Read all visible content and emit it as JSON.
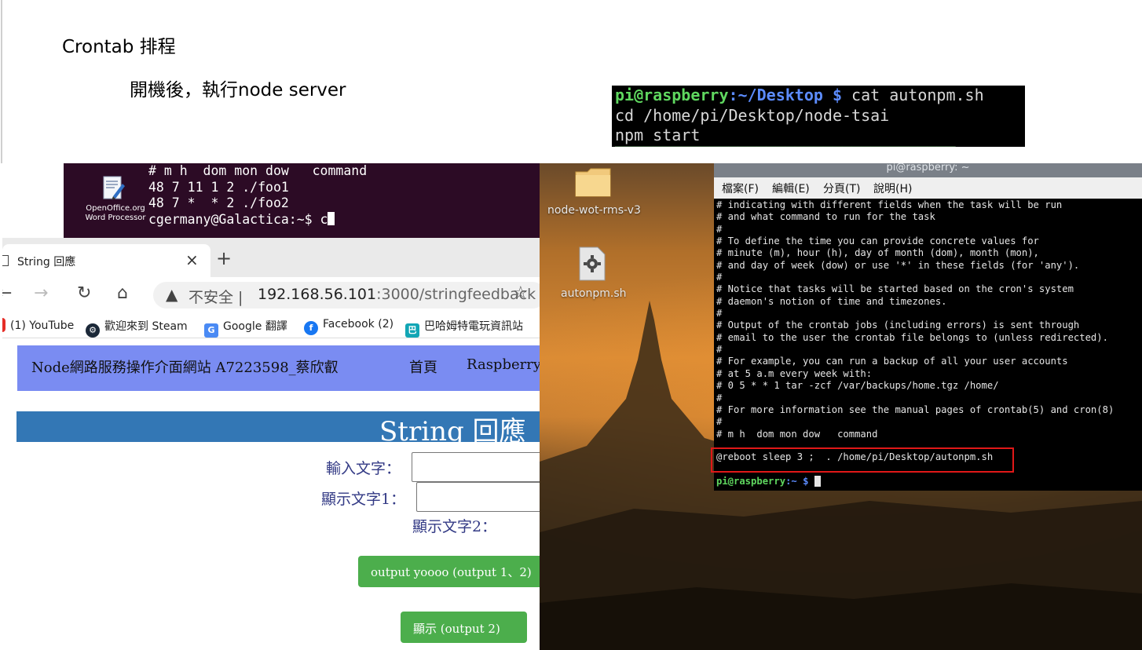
{
  "slide": {
    "title": "Crontab 排程",
    "subtitle": "開機後，執行node server"
  },
  "snippet": {
    "prompt_user": "pi@raspberry",
    "prompt_path": ":~/Desktop $",
    "command": " cat autonpm.sh",
    "line2": "cd /home/pi/Desktop/node-tsai",
    "line3": "npm start"
  },
  "ubuntu_terminal": {
    "icon_label": "OpenOffice.org Word Processor",
    "lines": [
      "# m h  dom mon dow   command",
      "48 7 11 1 2 ./foo1",
      "48 7 *  * 2 ./foo2"
    ],
    "prompt": "cgermany@Galactica:~$ c"
  },
  "browser": {
    "tab_title": "String 回應",
    "tab_close": "×",
    "new_tab": "+",
    "insecure_label": "不安全",
    "url_host": "192.168.56.101",
    "url_rest": ":3000/stringfeedback",
    "bookmarks": [
      "(1) YouTube",
      "歡迎來到 Steam",
      "Google 翻譯",
      "Facebook (2)",
      "巴哈姆特電玩資訊站"
    ]
  },
  "page": {
    "site_title": "Node網路服務操作介面網站 A7223598_蔡欣叡",
    "nav_home": "首頁",
    "nav_raspberry": "Raspberry",
    "heading": "String 回應",
    "input_label": "輸入文字：",
    "display1_label": "顯示文字1：",
    "display2_label": "顯示文字2：",
    "output_button": "output yoooo (output 1、2)",
    "show_button": "顯示 (output 2)"
  },
  "desktop": {
    "folder_label": "node-wot-rms-v3",
    "file_label": "autonpm.sh"
  },
  "lxterminal": {
    "title": "pi@raspberry: ~",
    "menu": [
      "檔案(F)",
      "編輯(E)",
      "分頁(T)",
      "說明(H)"
    ],
    "body": "# indicating with different fields when the task will be run\n# and what command to run for the task\n#\n# To define the time you can provide concrete values for\n# minute (m), hour (h), day of month (dom), month (mon),\n# and day of week (dow) or use '*' in these fields (for 'any').\n#\n# Notice that tasks will be started based on the cron's system\n# daemon's notion of time and timezones.\n#\n# Output of the crontab jobs (including errors) is sent through\n# email to the user the crontab file belongs to (unless redirected).\n#\n# For example, you can run a backup of all your user accounts\n# at 5 a.m every week with:\n# 0 5 * * 1 tar -zcf /var/backups/home.tgz /home/\n#\n# For more information see the manual pages of crontab(5) and cron(8)\n#\n# m h  dom mon dow   command",
    "reboot_line": "@reboot sleep 3 ;  . /home/pi/Desktop/autonpm.sh",
    "prompt_user": "pi@raspberry",
    "prompt_path": ":~ $"
  },
  "colors": {
    "navbar": "#7a8cf2",
    "heading_bar": "#3377b5",
    "button_green": "#4cae4c",
    "highlight_box": "#e01818",
    "terminal_green": "#5fd75f",
    "terminal_blue": "#5c8cff"
  }
}
